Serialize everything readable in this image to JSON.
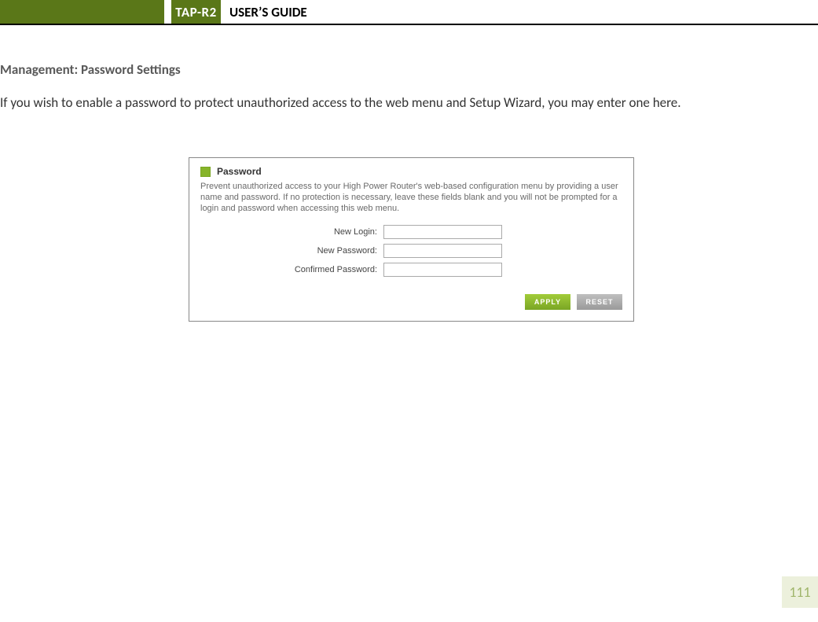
{
  "header": {
    "product": "TAP-R2",
    "title": "USER’S GUIDE"
  },
  "section": {
    "title": "Management: Password Settings",
    "body": "If you wish to enable a password to protect unauthorized access to the web menu and Setup Wizard, you may enter one here."
  },
  "panel": {
    "heading": "Password",
    "description": "Prevent unauthorized access to your High Power Router's web-based configuration menu by providing a user name and password. If no protection is necessary, leave these fields blank and you will not be prompted for a login and password when accessing this web menu.",
    "fields": {
      "new_login_label": "New Login:",
      "new_login_value": "",
      "new_password_label": "New Password:",
      "new_password_value": "",
      "confirm_password_label": "Confirmed Password:",
      "confirm_password_value": ""
    },
    "buttons": {
      "apply": "APPLY",
      "reset": "RESET"
    }
  },
  "page_number": "111"
}
